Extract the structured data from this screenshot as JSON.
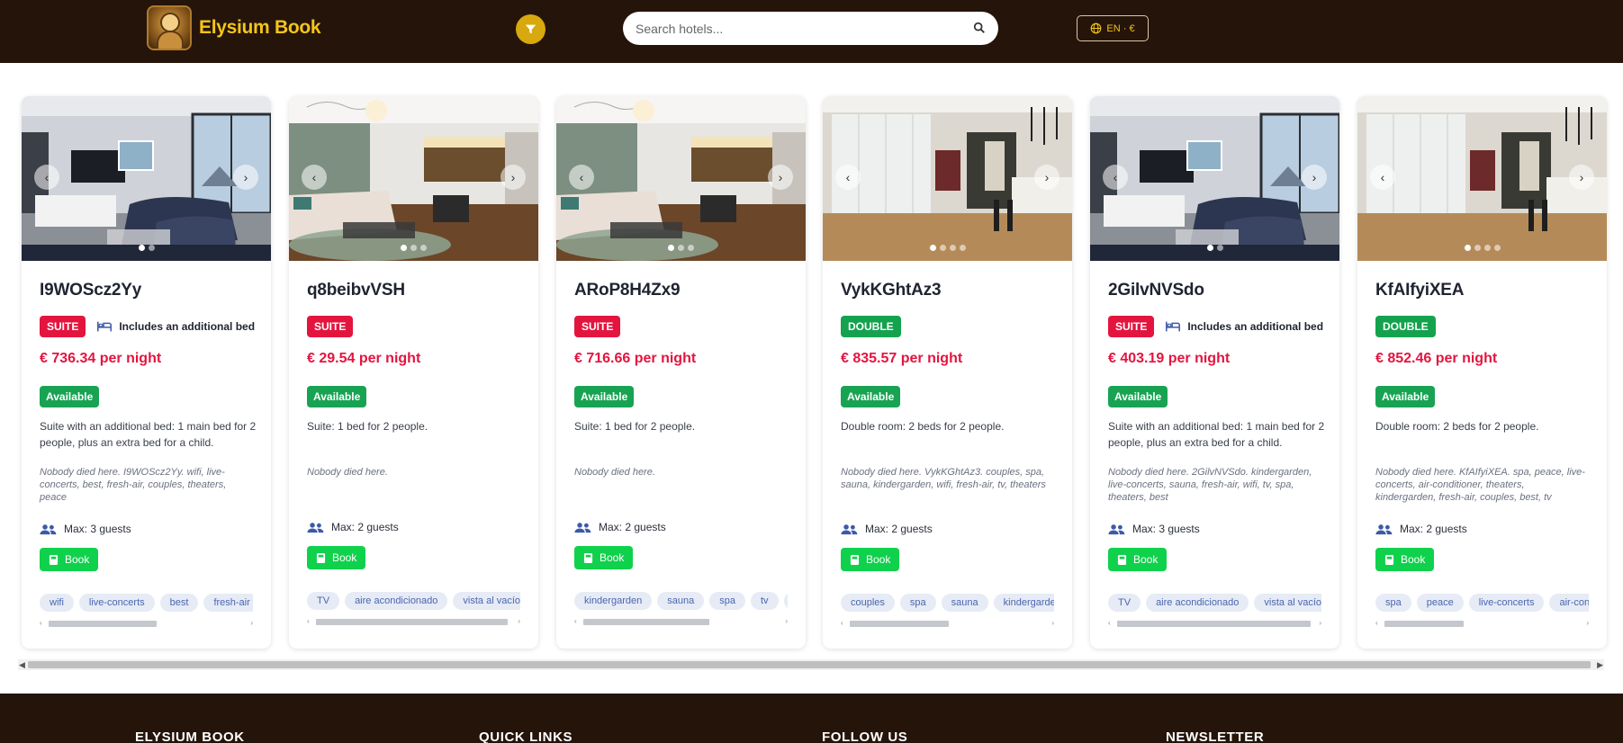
{
  "header": {
    "brand_name": "Elysium Book",
    "search_placeholder": "Search hotels...",
    "lang_label": "EN · €",
    "colors": {
      "bar": "#251409",
      "brand": "#f4c518",
      "filter": "#d8a80f"
    },
    "icons": [
      "filter-icon",
      "search-icon",
      "globe-icon"
    ]
  },
  "cards": [
    {
      "title": "I9WOScz2Yy",
      "type": "SUITE",
      "extra_bed": "Includes an additional bed",
      "price": "€ 736.34 per night",
      "status": "Available",
      "description": "Suite with an additional bed: 1 main bed for 2 people, plus an extra bed for a child.",
      "note": "Nobody died here. I9WOScz2Yy. wifi, live-concerts, best, fresh-air, couples, theaters, peace",
      "guests": "Max: 3 guests",
      "book": "Book",
      "tags": [
        "wifi",
        "live-concerts",
        "best",
        "fresh-air"
      ],
      "image_dots": 2,
      "active_dot": 0
    },
    {
      "title": "q8beibvVSH",
      "type": "SUITE",
      "extra_bed": "",
      "price": "€ 29.54 per night",
      "status": "Available",
      "description": "Suite: 1 bed for 2 people.",
      "note": "Nobody died here.",
      "guests": "Max: 2 guests",
      "book": "Book",
      "tags": [
        "TV",
        "aire acondicionado",
        "vista al vacío"
      ],
      "image_dots": 3,
      "active_dot": 0
    },
    {
      "title": "ARoP8H4Zx9",
      "type": "SUITE",
      "extra_bed": "",
      "price": "€ 716.66 per night",
      "status": "Available",
      "description": "Suite: 1 bed for 2 people.",
      "note": "Nobody died here.",
      "guests": "Max: 2 guests",
      "book": "Book",
      "tags": [
        "kindergarden",
        "sauna",
        "spa",
        "tv",
        "b"
      ],
      "image_dots": 3,
      "active_dot": 0
    },
    {
      "title": "VykKGhtAz3",
      "type": "DOUBLE",
      "extra_bed": "",
      "price": "€ 835.57 per night",
      "status": "Available",
      "description": "Double room: 2 beds for 2 people.",
      "note": "Nobody died here. VykKGhtAz3. couples, spa, sauna, kindergarden, wifi, fresh-air, tv, theaters",
      "guests": "Max: 2 guests",
      "book": "Book",
      "tags": [
        "couples",
        "spa",
        "sauna",
        "kindergarden"
      ],
      "image_dots": 4,
      "active_dot": 0
    },
    {
      "title": "2GilvNVSdo",
      "type": "SUITE",
      "extra_bed": "Includes an additional bed",
      "price": "€ 403.19 per night",
      "status": "Available",
      "description": "Suite with an additional bed: 1 main bed for 2 people, plus an extra bed for a child.",
      "note": "Nobody died here. 2GilvNVSdo. kindergarden, live-concerts, sauna, fresh-air, wifi, tv, spa, theaters, best",
      "guests": "Max: 3 guests",
      "book": "Book",
      "tags": [
        "TV",
        "aire acondicionado",
        "vista al vacío"
      ],
      "image_dots": 2,
      "active_dot": 0
    },
    {
      "title": "KfAIfyiXEA",
      "type": "DOUBLE",
      "extra_bed": "",
      "price": "€ 852.46 per night",
      "status": "Available",
      "description": "Double room: 2 beds for 2 people.",
      "note": "Nobody died here. KfAIfyiXEA. spa, peace, live-concerts, air-conditioner, theaters, kindergarden, fresh-air, couples, best, tv",
      "guests": "Max: 2 guests",
      "book": "Book",
      "tags": [
        "spa",
        "peace",
        "live-concerts",
        "air-condi"
      ],
      "image_dots": 4,
      "active_dot": 0
    }
  ],
  "footer": {
    "col1": "ELYSIUM BOOK",
    "col2": "QUICK LINKS",
    "col3": "FOLLOW US",
    "col4": "NEWSLETTER"
  }
}
